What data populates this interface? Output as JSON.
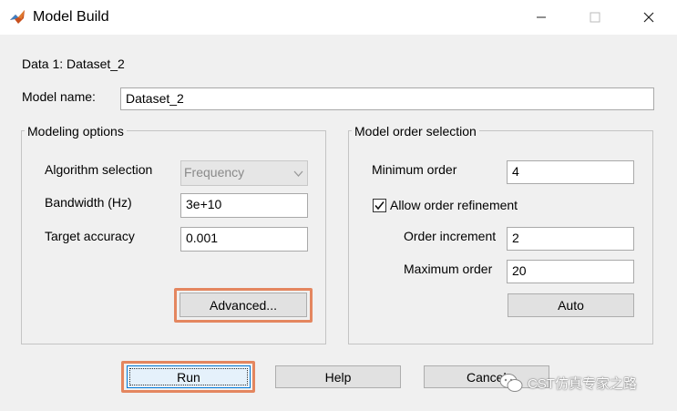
{
  "window": {
    "title": "Model Build",
    "controls": {
      "minimize": "—",
      "maximize": "☐",
      "close": "✕"
    }
  },
  "header": {
    "data_label": "Data 1: Dataset_2",
    "model_name_label": "Model name:",
    "model_name_value": "Dataset_2"
  },
  "modeling_options": {
    "title": "Modeling options",
    "algorithm_label": "Algorithm selection",
    "algorithm_value": "Frequency",
    "bandwidth_label": "Bandwidth (Hz)",
    "bandwidth_value": "3e+10",
    "accuracy_label": "Target accuracy",
    "accuracy_value": "0.001",
    "advanced_button": "Advanced..."
  },
  "model_order": {
    "title": "Model order selection",
    "minimum_label": "Minimum order",
    "minimum_value": "4",
    "refinement_label": "Allow order refinement",
    "refinement_checked": true,
    "increment_label": "Order increment",
    "increment_value": "2",
    "maximum_label": "Maximum order",
    "maximum_value": "20",
    "auto_button": "Auto"
  },
  "footer": {
    "run_button": "Run",
    "help_button": "Help",
    "cancel_button": "Cancel"
  },
  "watermark": {
    "text": "CST仿真专家之路"
  },
  "colors": {
    "highlight": "#e4865f",
    "accent": "#0078d7",
    "background": "#f0f0f0"
  }
}
